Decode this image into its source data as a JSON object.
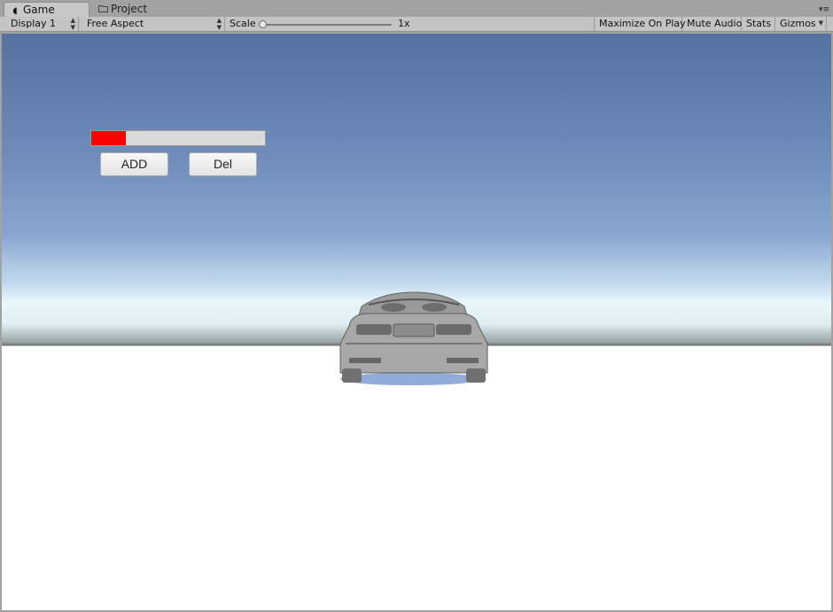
{
  "tabs": [
    {
      "label": "Game",
      "icon": "pacman-icon",
      "active": true
    },
    {
      "label": "Project",
      "icon": "folder-icon",
      "active": false
    }
  ],
  "toolbar": {
    "display": "Display 1",
    "aspect": "Free Aspect",
    "scale_label": "Scale",
    "scale_value": "1x",
    "maximize": "Maximize On Play",
    "mute": "Mute Audio",
    "stats": "Stats",
    "gizmos": "Gizmos"
  },
  "game": {
    "progress_fraction": 0.2,
    "add_label": "ADD",
    "del_label": "Del"
  },
  "colors": {
    "progress_fill": "#ff0000",
    "sky_top": "#55719f",
    "horizon": "#e9f7fb",
    "ground": "#ffffff"
  }
}
